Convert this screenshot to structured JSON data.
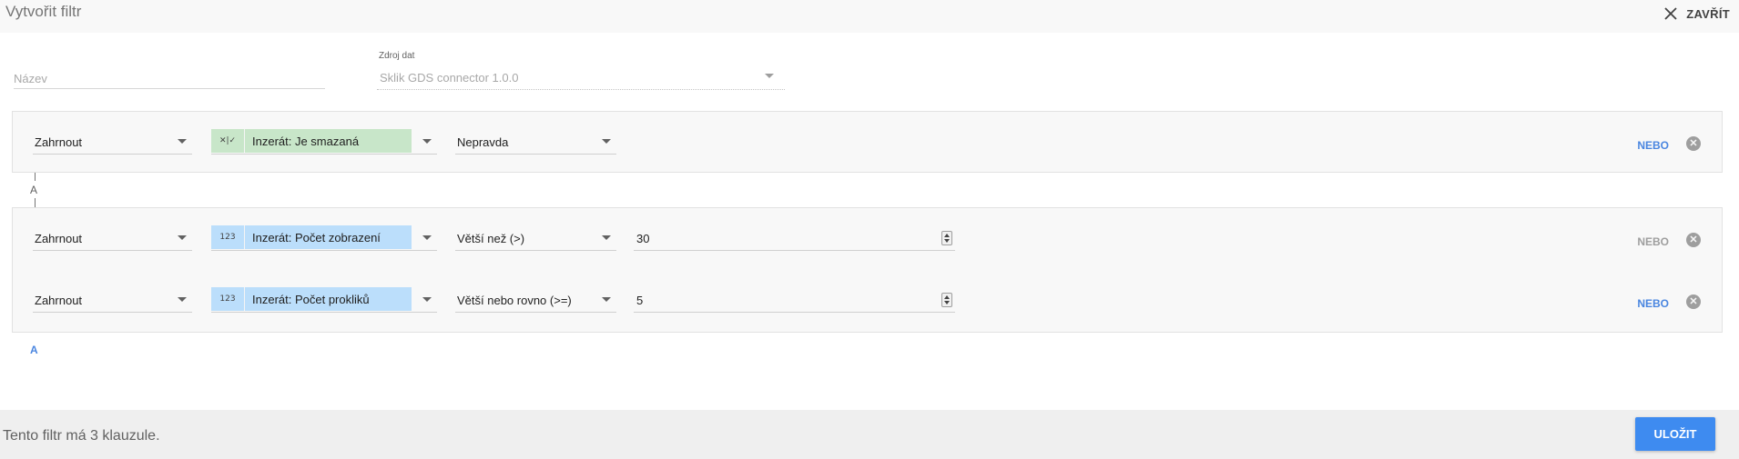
{
  "header": {
    "title": "Vytvořit filtr",
    "close_label": "ZAVŘÍT"
  },
  "form": {
    "name_placeholder": "Název",
    "source_label": "Zdroj dat",
    "source_value": "Sklik GDS connector 1.0.0"
  },
  "groups": [
    {
      "clauses": [
        {
          "include": "Zahrnout",
          "field_icon": "✕|✓",
          "field": "Inzerát: Je smazaná",
          "field_type": "boolean",
          "operator": "Nepravda",
          "value": "",
          "or_label": "NEBO",
          "or_active": true
        }
      ]
    },
    {
      "clauses": [
        {
          "include": "Zahrnout",
          "field_icon": "123",
          "field": "Inzerát: Počet zobrazení",
          "field_type": "number",
          "operator": "Větší než (>)",
          "value": "30",
          "or_label": "NEBO",
          "or_active": false
        },
        {
          "include": "Zahrnout",
          "field_icon": "123",
          "field": "Inzerát: Počet prokliků",
          "field_type": "number",
          "operator": "Větší nebo rovno (>=)",
          "value": "5",
          "or_label": "NEBO",
          "or_active": true
        }
      ]
    }
  ],
  "connector": {
    "and_label": "A"
  },
  "add_and_label": "A",
  "footer": {
    "summary": "Tento filtr má 3 klauzule.",
    "save_label": "ULOŽIT"
  },
  "colors": {
    "accent": "#4a86e0",
    "save_button": "#3e8bf0",
    "boolean_chip": "#c8e6c9",
    "number_chip": "#bbdefb"
  }
}
